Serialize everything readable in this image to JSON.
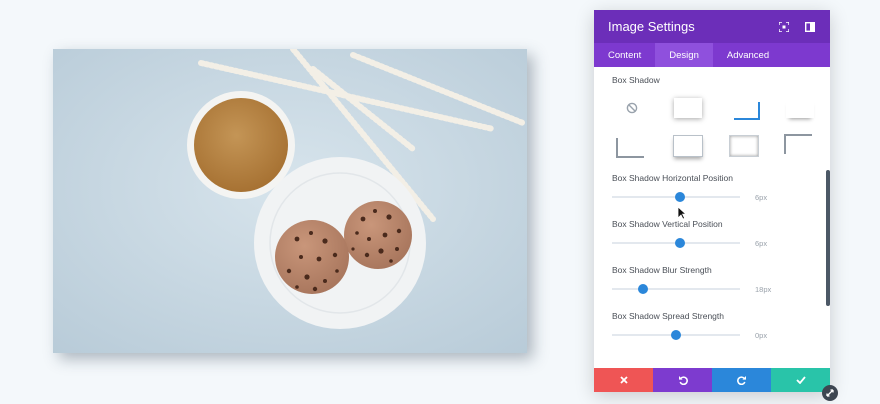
{
  "panel": {
    "title": "Image Settings",
    "header_icons": [
      "fullscreen-icon",
      "sidebar-toggle-icon"
    ],
    "tabs": [
      {
        "label": "Content",
        "active": false
      },
      {
        "label": "Design",
        "active": true
      },
      {
        "label": "Advanced",
        "active": false
      }
    ],
    "box_shadow_label": "Box Shadow",
    "box_shadow_presets": [
      "none",
      "preset-1",
      "preset-2",
      "preset-3",
      "preset-4",
      "preset-5",
      "preset-6",
      "preset-7"
    ],
    "sliders": [
      {
        "label": "Box Shadow Horizontal Position",
        "value": "6px",
        "level": 0.53
      },
      {
        "label": "Box Shadow Vertical Position",
        "value": "6px",
        "level": 0.53
      },
      {
        "label": "Box Shadow Blur Strength",
        "value": "18px",
        "level": 0.24
      },
      {
        "label": "Box Shadow Spread Strength",
        "value": "0px",
        "level": 0.5
      }
    ],
    "footer": [
      {
        "name": "cancel",
        "icon": "close-icon",
        "color": "#ef5555"
      },
      {
        "name": "undo",
        "icon": "undo-icon",
        "color": "#7d3bcf"
      },
      {
        "name": "redo",
        "icon": "redo-icon",
        "color": "#2b87da"
      },
      {
        "name": "save",
        "icon": "check-icon",
        "color": "#29c4a9"
      }
    ]
  },
  "colors": {
    "header": "#6c2eb9",
    "tabs": "#7d39cf",
    "accent": "#2b87da"
  }
}
